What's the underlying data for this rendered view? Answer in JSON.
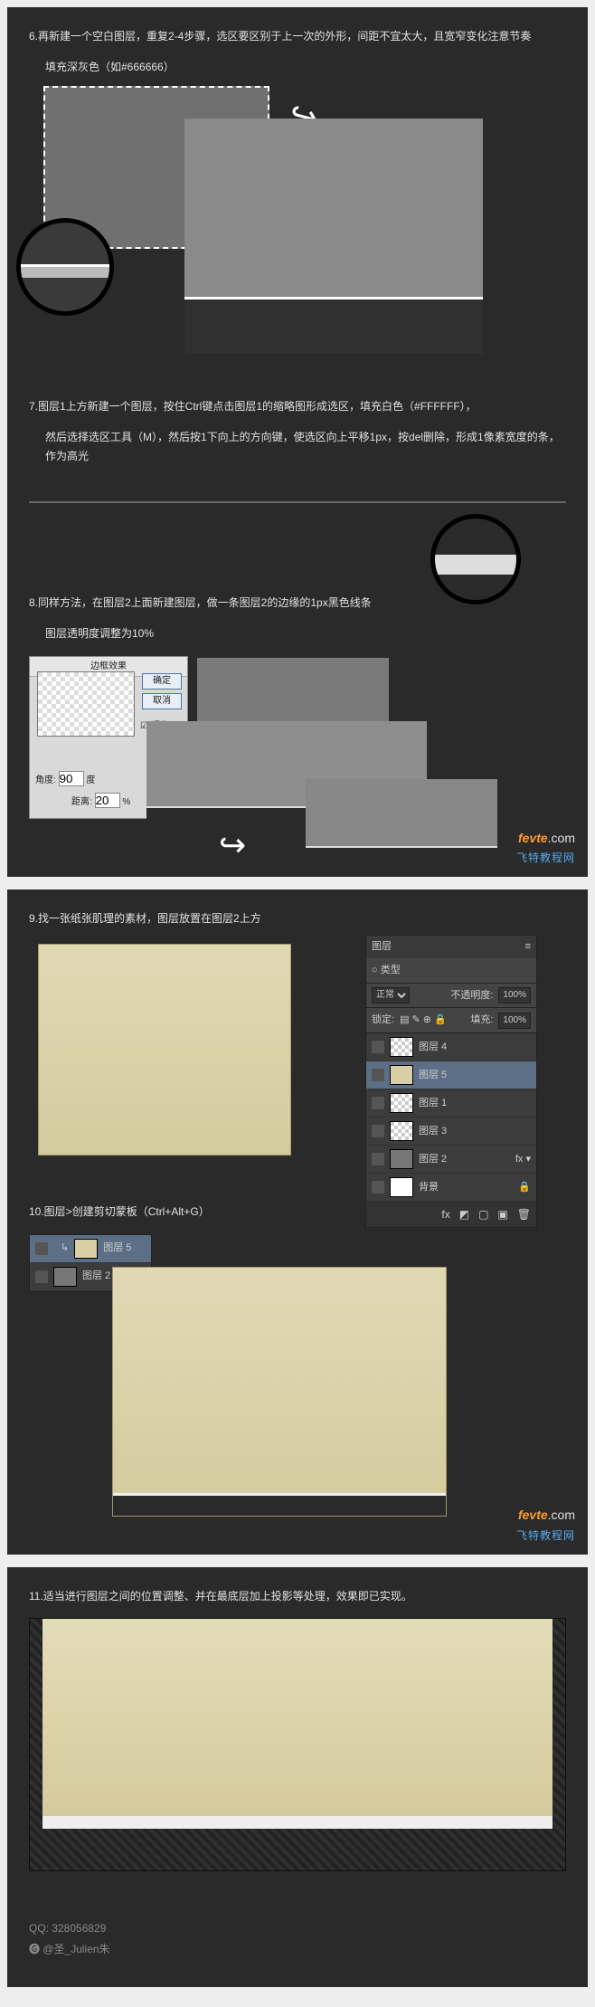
{
  "steps": {
    "s6": "6.再新建一个空白图层，重复2-4步骤，选区要区别于上一次的外形，间距不宜太大，且宽窄变化注意节奏",
    "s6b": "填充深灰色（如#666666）",
    "s7": "7.图层1上方新建一个图层，按住Ctrl键点击图层1的缩略图形成选区，填充白色（#FFFFFF），",
    "s7b": "然后选择选区工具（M），然后按1下向上的方向键，使选区向上平移1px，按del删除，形成1像素宽度的条，作为高光",
    "s8a": "8.同样方法，在图层2上面新建图层，做一条图层2的边缘的1px黑色线条",
    "s8b": "图层透明度调整为10%",
    "s9": "9.找一张纸张肌理的素材，图层放置在图层2上方",
    "s10": "10.图层>创建剪切蒙板（Ctrl+Alt+G）",
    "s11": "11.适当进行图层之间的位置调整、并在最底层加上投影等处理，效果即已实现。"
  },
  "dlg": {
    "title": "边框效果",
    "ok": "确定",
    "cancel": "取消",
    "preview": "☑ 预览",
    "angle_label": "角度:",
    "angle_val": "90",
    "deg": "度",
    "dist_label": "距离:",
    "dist_val": "20",
    "perc": "%"
  },
  "layers": {
    "title": "图层",
    "tab1": "○ 类型",
    "blend": "正常",
    "opacity_label": "不透明度:",
    "opacity": "100%",
    "lock_label": "锁定:",
    "fill_label": "填充:",
    "fill": "100%",
    "items": [
      "图层 4",
      "图层 5",
      "图层 1",
      "图层 3",
      "图层 2",
      "背景"
    ],
    "items2": [
      "图层 5",
      "图层 2"
    ]
  },
  "wm": {
    "a": "fevte",
    "b": ".com",
    "sub": "飞特教程网"
  },
  "credits": {
    "qq": "QQ: 328056829",
    "weibo": "@圣_Julien朱"
  }
}
